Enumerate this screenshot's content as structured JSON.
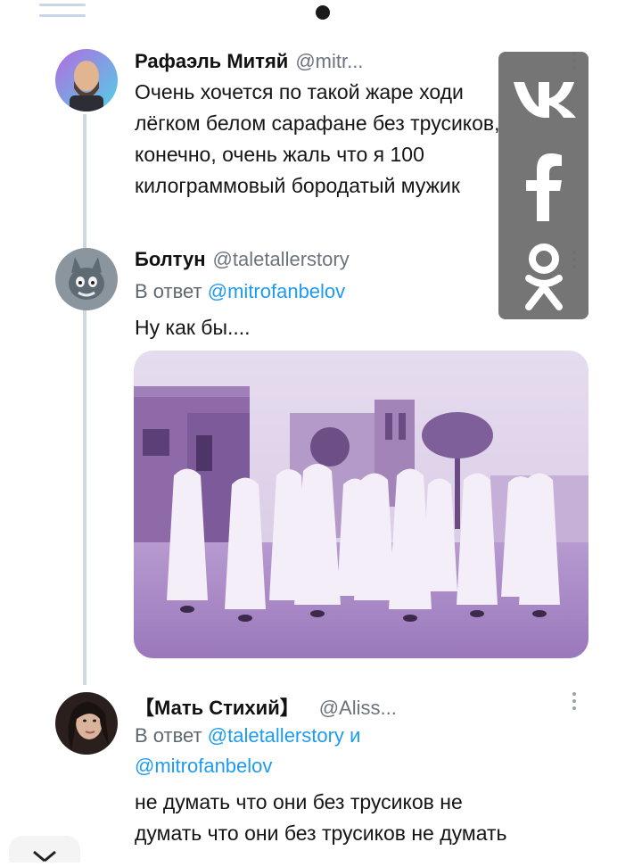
{
  "top_bar": {
    "menu_icon": "hamburger-lines",
    "dot_icon": "page-dot"
  },
  "tweets": [
    {
      "name": "Рафаэль Митяй",
      "handle": "@mitr...",
      "avatar": "bald-bearded-man-avatar",
      "text_lines": [
        "Очень хочется по такой жаре ходи",
        "лёгком белом сарафане без трусиков,",
        "конечно, очень жаль что я 100",
        "килограммовый бородатый мужик"
      ]
    },
    {
      "name": "Болтун",
      "handle": "@taletallerstory",
      "avatar": "cartoon-cat-avatar",
      "reply_prefix": "В ответ",
      "reply_mention": "@mitrofanbelov",
      "text_lines": [
        "Ну как бы...."
      ],
      "image": "men-in-white-robes-walking-photo"
    },
    {
      "name": "【Мать Стихий】",
      "handle": "@Aliss...",
      "avatar": "woman-portrait-avatar",
      "reply_prefix": "В ответ",
      "reply_mention": "@taletallerstory",
      "reply_joiner": "и",
      "reply_mention2": "@mitrofanbelov",
      "text_lines": [
        "не думать что они без трусиков не",
        "думать что они без трусиков не думать"
      ]
    }
  ],
  "social_panel": {
    "icons": [
      "vk-icon",
      "facebook-icon",
      "odnoklassniki-icon"
    ],
    "color": "#6e6e6e"
  },
  "bottom_bar": {
    "close_icon": "close-icon"
  },
  "colors": {
    "mention": "#1d9bf0",
    "handle": "#6b737c",
    "thread_line": "#cfd7df"
  }
}
